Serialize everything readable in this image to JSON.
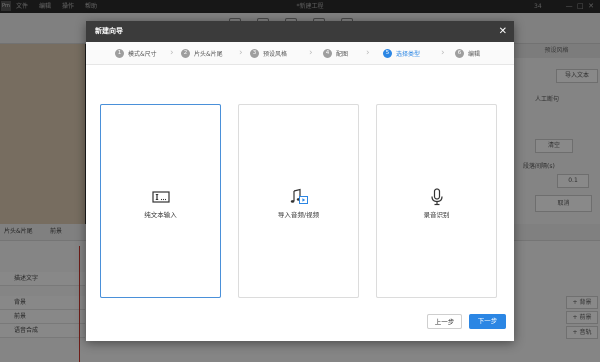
{
  "app": {
    "logo": "Pm",
    "menu": [
      "文件",
      "编辑",
      "操作",
      "帮助"
    ],
    "window_title": "*新建工程",
    "title_number": "34"
  },
  "right_panel": {
    "tab": "预设风格",
    "import_text": "导入文本",
    "manual_pause": "人工断句",
    "clear": "清空",
    "pause_interval_label": "段落间隔(s)",
    "pause_interval_value": "0.1",
    "cancel": "取消"
  },
  "timeline": {
    "tab_head_tail": "片头&片尾",
    "tab_bg": "前景",
    "tracks": [
      "描述文字",
      "背景",
      "前景",
      "语音合成"
    ],
    "add_buttons": [
      "+ 背景",
      "+ 前景",
      "+ 音轨"
    ]
  },
  "modal": {
    "title": "新建向导",
    "close_icon": "close-icon",
    "steps": [
      {
        "num": "1",
        "label": "模式&尺寸"
      },
      {
        "num": "2",
        "label": "片头&片尾"
      },
      {
        "num": "3",
        "label": "预设风格"
      },
      {
        "num": "4",
        "label": "配图"
      },
      {
        "num": "5",
        "label": "选择类型"
      },
      {
        "num": "6",
        "label": "编辑"
      }
    ],
    "active_step": 5,
    "cards": [
      {
        "label": "纯文本输入",
        "icon": "text-input-icon",
        "selected": true
      },
      {
        "label": "导入音频/视频",
        "icon": "music-video-icon",
        "selected": false
      },
      {
        "label": "录音识别",
        "icon": "microphone-icon",
        "selected": false
      }
    ],
    "prev_button": "上一步",
    "next_button": "下一步"
  },
  "colors": {
    "accent": "#2b86e4",
    "header": "#3b3b3b",
    "overlay": "rgba(0,0,0,0.45)"
  }
}
